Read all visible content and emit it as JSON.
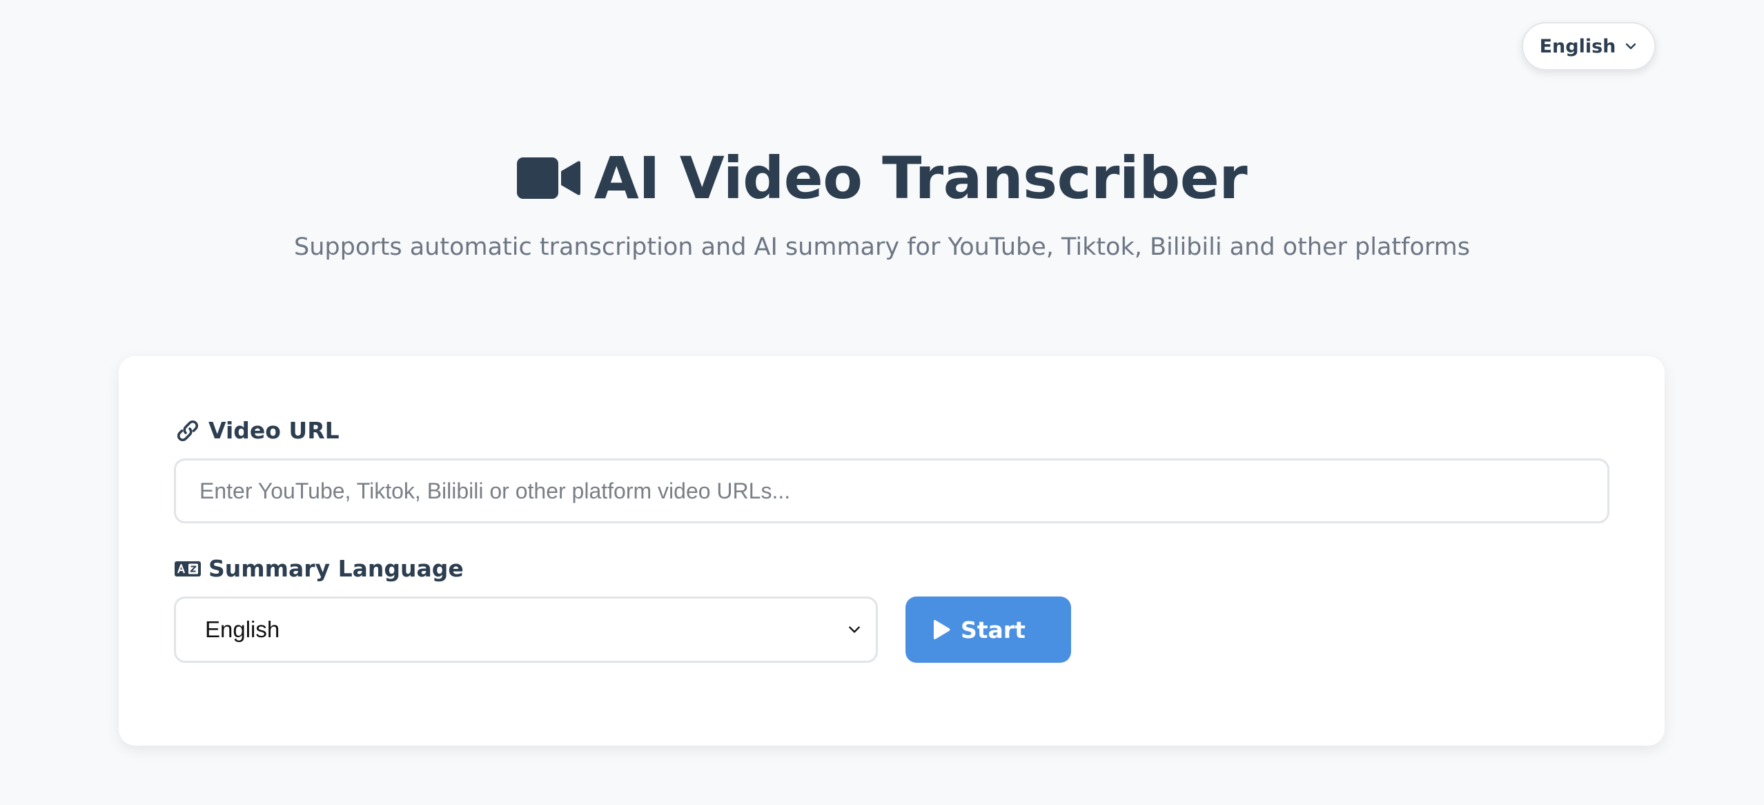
{
  "language_switch": {
    "label": "English",
    "icon": "chevron-down-icon"
  },
  "header": {
    "icon": "video-camera-icon",
    "title": "AI Video Transcriber",
    "subtitle": "Supports automatic transcription and AI summary for YouTube, Tiktok, Bilibili and other platforms"
  },
  "form": {
    "url_field": {
      "icon": "link-icon",
      "label": "Video URL",
      "value": "",
      "placeholder": "Enter YouTube, Tiktok, Bilibili or other platform video URLs..."
    },
    "language_field": {
      "icon": "language-icon",
      "label": "Summary Language",
      "selected": "English"
    },
    "start_button": {
      "icon": "play-icon",
      "label": "Start"
    }
  },
  "colors": {
    "background": "#f8f9fb",
    "text_primary": "#2c3e50",
    "text_secondary": "#6c7683",
    "accent": "#4a90e2",
    "border": "#e1e4e8"
  }
}
